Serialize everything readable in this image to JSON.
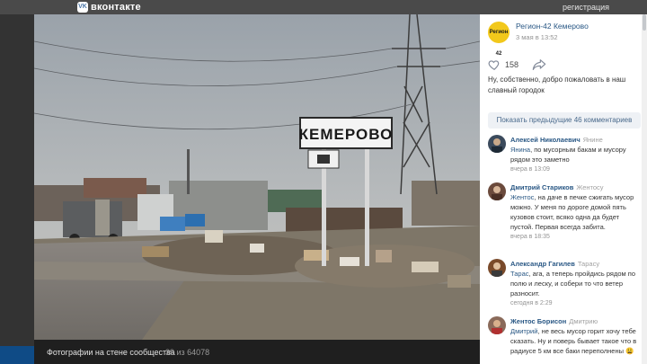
{
  "header": {
    "brand": "вконтакте",
    "brand_icon": "vk-logo-icon",
    "register_link": "регистрация"
  },
  "photo": {
    "sign_text": "КЕМЕРОВО",
    "caption": "Фотографии на стене сообщества",
    "counter": "39 из 64078"
  },
  "post": {
    "group_avatar_text": "Регион 42",
    "group_name": "Регион-42 Кемерово",
    "date": "3 мая в 13:52",
    "likes": "158",
    "text": "Ну, собственно, добро пожаловать в наш славный городок",
    "show_previous": "Показать предыдущие 46 комментариев"
  },
  "comments": [
    {
      "author": "Алексей Николаевич",
      "reply_to": "Янине",
      "mention": "Янина",
      "text": ", по мусорным бакам и мусору рядом это заметно",
      "date": "вчера в 13:09"
    },
    {
      "author": "Дмитрий Стариков",
      "reply_to": "Жентосу",
      "mention": "Жентос",
      "text": ", на даче в печке сжигать мусор можно. У меня по дороге домой пять кузовов стоит, всяко одна да будет пустой. Первая всегда забита.",
      "date": "вчера в 18:35"
    },
    {
      "author": "Александр Гагилев",
      "reply_to": "Тарасу",
      "mention": "Тарас",
      "text": ", ага, а теперь пройдись рядом по полю и леску, и собери то что ветер разносит.",
      "date": "сегодня в 2:29"
    },
    {
      "author": "Жентос Борисон",
      "reply_to": "Дмитрию",
      "mention": "Дмитрий",
      "text": ", не весь мусор горит хочу тебе сказать. Ну и поверь бывает такое что в радиусе 5 км все баки переполнены 😩",
      "date": ""
    }
  ],
  "colors": {
    "link": "#2a5885",
    "accent_avatar": "#f2c81b",
    "vk_blue": "#4a76a8"
  }
}
